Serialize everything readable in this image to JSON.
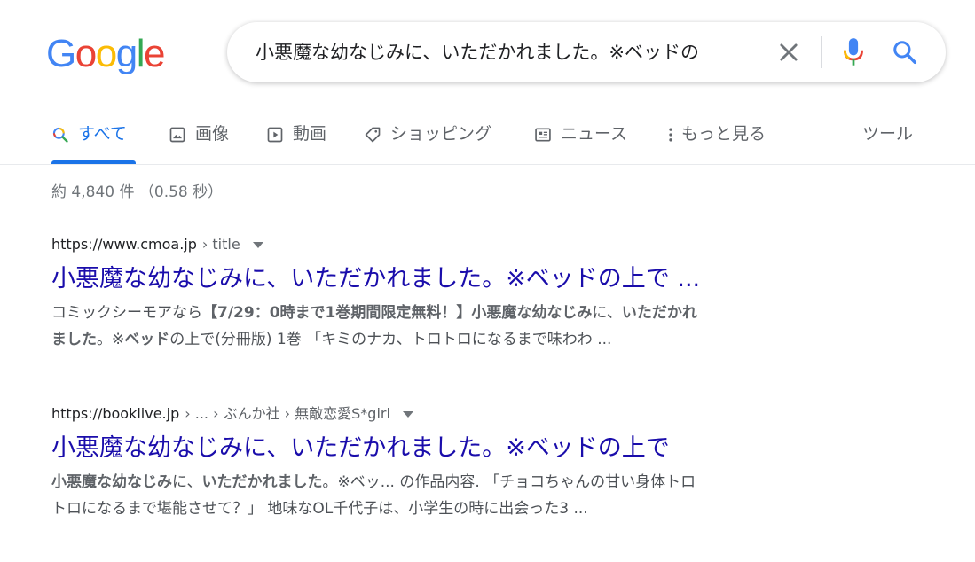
{
  "logo": {
    "letters": [
      {
        "ch": "G",
        "color": "#4285F4"
      },
      {
        "ch": "o",
        "color": "#EA4335"
      },
      {
        "ch": "o",
        "color": "#FBBC05"
      },
      {
        "ch": "g",
        "color": "#4285F4"
      },
      {
        "ch": "l",
        "color": "#34A853"
      },
      {
        "ch": "e",
        "color": "#EA4335"
      }
    ]
  },
  "search": {
    "query": "小悪魔な幼なじみに、いただかれました。※ベッドの",
    "icons": {
      "clear": "close-icon",
      "voice": "mic-icon",
      "submit": "search-icon"
    }
  },
  "tabs": [
    {
      "label": "すべて",
      "icon": "search-icon",
      "active": true
    },
    {
      "label": "画像",
      "icon": "image-icon",
      "active": false
    },
    {
      "label": "動画",
      "icon": "video-icon",
      "active": false
    },
    {
      "label": "ショッピング",
      "icon": "tag-icon",
      "active": false
    },
    {
      "label": "ニュース",
      "icon": "news-icon",
      "active": false
    },
    {
      "label": "もっと見る",
      "icon": "more-vert-icon",
      "active": false
    }
  ],
  "tools_label": "ツール",
  "result_stats": "約 4,840 件 （0.58 秒）",
  "results": [
    {
      "url": "https://www.cmoa.jp",
      "breadcrumb": "› title",
      "title": "小悪魔な幼なじみに、いただかれました。※ベッドの上で ...",
      "snippet_lines": [
        [
          {
            "t": "コミックシーモアなら",
            "b": false
          },
          {
            "t": "【7/29：0時まで1巻期間限定無料！】小悪魔な幼なじみ",
            "b": true
          },
          {
            "t": "に、",
            "b": false
          },
          {
            "t": "いただかれ",
            "b": true
          }
        ],
        [
          {
            "t": "ました",
            "b": true
          },
          {
            "t": "。※",
            "b": false
          },
          {
            "t": "ベッド",
            "b": true
          },
          {
            "t": "の上で(分冊版) 1巻 「キミのナカ、トロトロになるまで味わわ ...",
            "b": false
          }
        ]
      ]
    },
    {
      "url": "https://booklive.jp",
      "breadcrumb": "› ... › ぶんか社 › 無敵恋愛S*girl",
      "title": "小悪魔な幼なじみに、いただかれました。※ベッドの上で",
      "snippet_lines": [
        [
          {
            "t": "小悪魔な幼なじみ",
            "b": true
          },
          {
            "t": "に、",
            "b": false
          },
          {
            "t": "いただかれました",
            "b": true
          },
          {
            "t": "。※ベッ... の作品内容. 「チョコちゃんの甘い身体トロ",
            "b": false
          }
        ],
        [
          {
            "t": "トロになるまで堪能させて？」 地味なOL千代子は、小学生の時に出会った3 ...",
            "b": false
          }
        ]
      ]
    }
  ]
}
